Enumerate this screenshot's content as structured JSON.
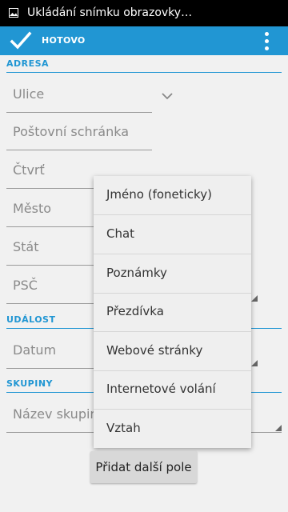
{
  "status_bar": {
    "text": "Ukládání snímku obrazovky…"
  },
  "action_bar": {
    "done_label": "HOTOVO"
  },
  "sections": {
    "address": {
      "header": "ADRESA",
      "fields": [
        "Ulice",
        "Poštovní schránka",
        "Čtvrť",
        "Město",
        "Stát",
        "PSČ"
      ]
    },
    "event": {
      "header": "UDÁLOST",
      "field": "Datum"
    },
    "groups": {
      "header": "SKUPINY",
      "field": "Název skupiny"
    }
  },
  "popup_menu": {
    "items": [
      "Jméno (foneticky)",
      "Chat",
      "Poznámky",
      "Přezdívka",
      "Webové stránky",
      "Internetové volání",
      "Vztah"
    ]
  },
  "add_field_button": "Přidat další pole",
  "colors": {
    "accent": "#2196d3",
    "status_bar": "#000000",
    "background": "#f1f1f1"
  },
  "icons": [
    "picture-icon",
    "checkmark-icon",
    "overflow-menu-icon",
    "chevron-down-icon"
  ]
}
